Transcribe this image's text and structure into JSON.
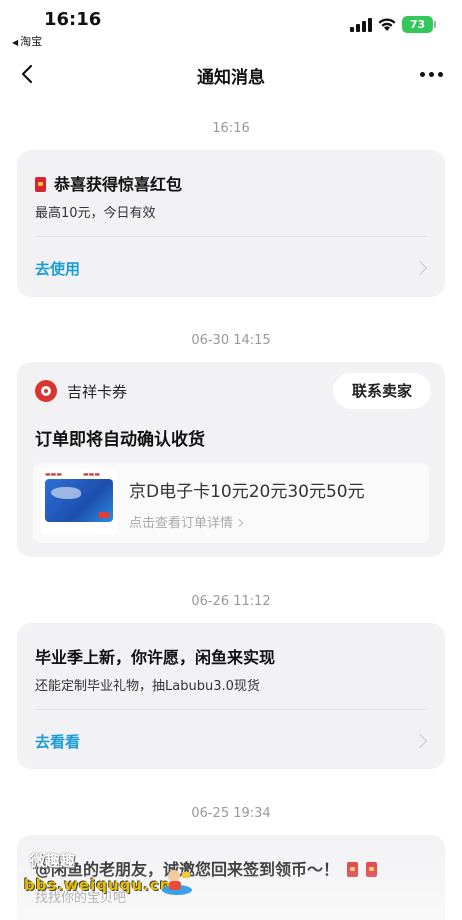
{
  "status_bar": {
    "time": "16:16",
    "back_app": "淘宝",
    "battery": "73"
  },
  "nav": {
    "title": "通知消息"
  },
  "messages": [
    {
      "timestamp": "16:16",
      "title": "恭喜获得惊喜红包",
      "subtitle": "最高10元，今日有效",
      "action": "去使用"
    },
    {
      "timestamp": "06-30 14:15",
      "shop_name": "吉祥卡券",
      "contact_button": "联系卖家",
      "title": "订单即将自动确认收货",
      "product_name": "京D电子卡10元20元30元50元",
      "product_detail": "点击查看订单详情"
    },
    {
      "timestamp": "06-26 11:12",
      "title": "毕业季上新，你许愿，闲鱼来实现",
      "subtitle": "还能定制毕业礼物，抽Labubu3.0现货",
      "action": "去看看"
    },
    {
      "timestamp": "06-25 19:34",
      "title": "@闲鱼的老朋友，诚邀您回来签到领币～！",
      "subtitle": "找找你的宝贝吧"
    }
  ],
  "watermark": {
    "line1": "微趣趣",
    "line2": "bbs.weiququ.cn"
  },
  "colors": {
    "link": "#1c9cd8",
    "card_bg": "#f2f2f4",
    "battery": "#34c759",
    "red": "#d9252f"
  }
}
